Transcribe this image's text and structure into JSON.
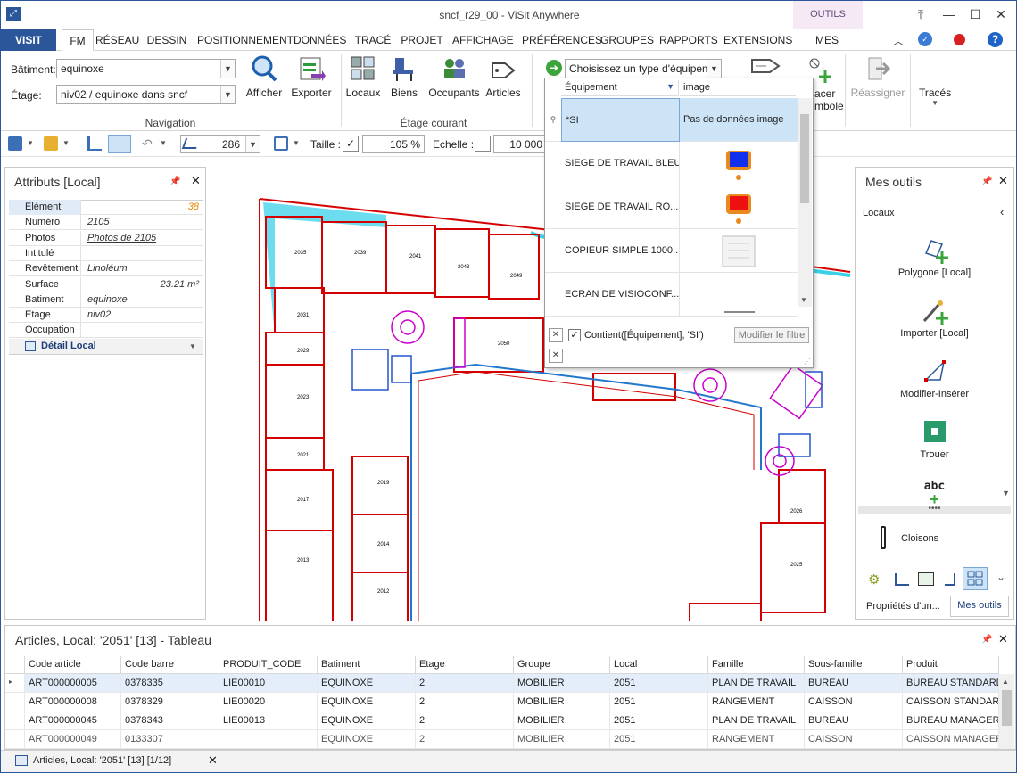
{
  "window": {
    "title": "sncf_r29_00 - ViSit Anywhere",
    "context_tab": "OUTILS"
  },
  "tabs": [
    "VISIT",
    "FM",
    "RÉSEAU",
    "DESSIN",
    "POSITIONNEMENT",
    "DONNÉES",
    "TRACÉ",
    "PROJET",
    "AFFICHAGE",
    "PRÉFÉRENCES",
    "GROUPES",
    "RAPPORTS",
    "EXTENSIONS",
    "MES OUTILS"
  ],
  "ribbon": {
    "batiment_label": "Bâtiment:",
    "batiment_value": "equinoxe",
    "etage_label": "Étage:",
    "etage_value": "niv02 / equinoxe dans sncf",
    "afficher": "Afficher",
    "exporter": "Exporter",
    "navigation_group": "Navigation",
    "locaux": "Locaux",
    "biens": "Biens",
    "occupants": "Occupants",
    "articles": "Articles",
    "etage_courant_group": "Étage courant",
    "equipment_combo": "Choisissez un type d'équipem...",
    "placer_symbole_1": "acer",
    "placer_symbole_2": "mbole",
    "reassigner": "Réassigner",
    "traces": "Tracés"
  },
  "toolbar": {
    "angle": "286",
    "taille_label": "Taille :",
    "taille_value": "105 %",
    "echelle_label": "Echelle :",
    "echelle_value": "10 000"
  },
  "attributes": {
    "title": "Attributs [Local]",
    "rows": [
      {
        "k": "Elément",
        "v": "38"
      },
      {
        "k": "Numéro",
        "v": "2105"
      },
      {
        "k": "Photos",
        "v": "Photos de 2105"
      },
      {
        "k": "Intitulé",
        "v": ""
      },
      {
        "k": "Revêtement",
        "v": "Linoléum"
      },
      {
        "k": "Surface",
        "v": "23.21 m²"
      },
      {
        "k": "Batiment",
        "v": "equinoxe"
      },
      {
        "k": "Etage",
        "v": "niv02"
      },
      {
        "k": "Occupation",
        "v": ""
      }
    ],
    "detail": "Détail Local"
  },
  "popup": {
    "col1": "Équipement",
    "col2": "image",
    "rows": [
      {
        "name": "*SI",
        "image": "Pas de données image"
      },
      {
        "name": "SIEGE DE TRAVAIL BLEU",
        "image": ""
      },
      {
        "name": "SIEGE DE TRAVAIL RO...",
        "image": ""
      },
      {
        "name": "COPIEUR SIMPLE 1000...",
        "image": ""
      },
      {
        "name": "ECRAN DE VISIOCONF...",
        "image": ""
      }
    ],
    "filter": "Contient([Équipement], 'SI')",
    "modify_filter": "Modifier le filtre"
  },
  "plan_rooms": [
    "2035",
    "2039",
    "2041",
    "2043",
    "2049",
    "2031",
    "2029",
    "2023",
    "2021",
    "2017",
    "2013",
    "2019",
    "2014",
    "2012",
    "2050",
    "2026",
    "2025"
  ],
  "tools": {
    "title": "Mes outils",
    "section": "Locaux",
    "items": [
      "Polygone [Local]",
      "Importer [Local]",
      "Modifier-Insérer",
      "Trouer",
      "abc",
      "Cloisons"
    ],
    "tab1": "Propriétés d'un...",
    "tab2": "Mes outils"
  },
  "table": {
    "title": "Articles, Local: '2051' [13] - Tableau",
    "columns": [
      "Code article",
      "Code barre",
      "PRODUIT_CODE",
      "Batiment",
      "Etage",
      "Groupe",
      "Local",
      "Famille",
      "Sous-famille",
      "Produit"
    ],
    "rows": [
      [
        "ART000000005",
        "0378335",
        "LIE00010",
        "EQUINOXE",
        "2",
        "MOBILIER",
        "2051",
        "PLAN DE TRAVAIL",
        "BUREAU",
        "BUREAU STANDARD"
      ],
      [
        "ART000000008",
        "0378329",
        "LIE00020",
        "EQUINOXE",
        "2",
        "MOBILIER",
        "2051",
        "RANGEMENT",
        "CAISSON",
        "CAISSON STANDARD"
      ],
      [
        "ART000000045",
        "0378343",
        "LIE00013",
        "EQUINOXE",
        "2",
        "MOBILIER",
        "2051",
        "PLAN DE TRAVAIL",
        "BUREAU",
        "BUREAU MANAGER"
      ],
      [
        "ART000000049",
        "0133307",
        "",
        "EQUINOXE",
        "2",
        "MOBILIER",
        "2051",
        "RANGEMENT",
        "CAISSON",
        "CAISSON MANAGER"
      ]
    ],
    "status_tab": "Articles, Local: '2051' [13] [1/12]"
  },
  "colors": {
    "accent": "#2b579a",
    "plan_wall": "#d40000",
    "selection": "#cde4f7"
  }
}
